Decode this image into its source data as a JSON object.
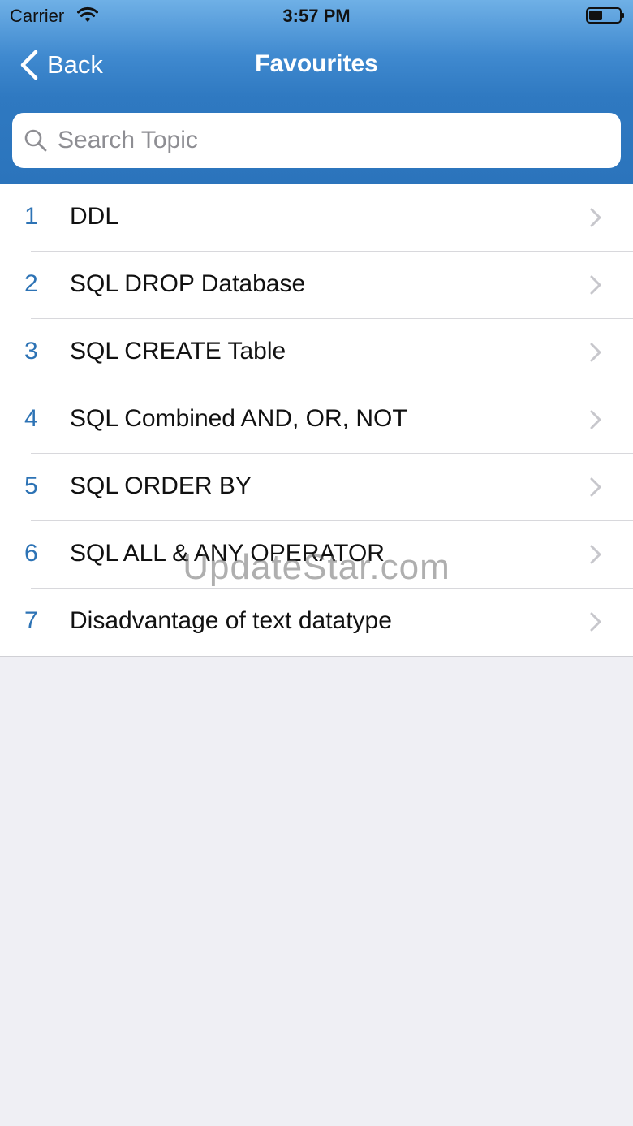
{
  "status_bar": {
    "carrier": "Carrier",
    "time": "3:57 PM",
    "wifi_icon": "wifi-icon",
    "battery_icon": "battery-icon"
  },
  "nav": {
    "back_label": "Back",
    "title": "Favourites"
  },
  "search": {
    "placeholder": "Search Topic",
    "value": ""
  },
  "favourites": [
    {
      "number": "1",
      "title": "DDL"
    },
    {
      "number": "2",
      "title": "SQL DROP Database"
    },
    {
      "number": "3",
      "title": "SQL CREATE Table"
    },
    {
      "number": "4",
      "title": "SQL Combined AND, OR, NOT"
    },
    {
      "number": "5",
      "title": "SQL ORDER BY"
    },
    {
      "number": "6",
      "title": "SQL ALL & ANY OPERATOR"
    },
    {
      "number": "7",
      "title": "Disadvantage of text datatype"
    }
  ],
  "watermark": "UpdateStar.com",
  "colors": {
    "nav_bar": "#2f79c1",
    "accent_number": "#2d73b5",
    "background": "#efeff4"
  }
}
